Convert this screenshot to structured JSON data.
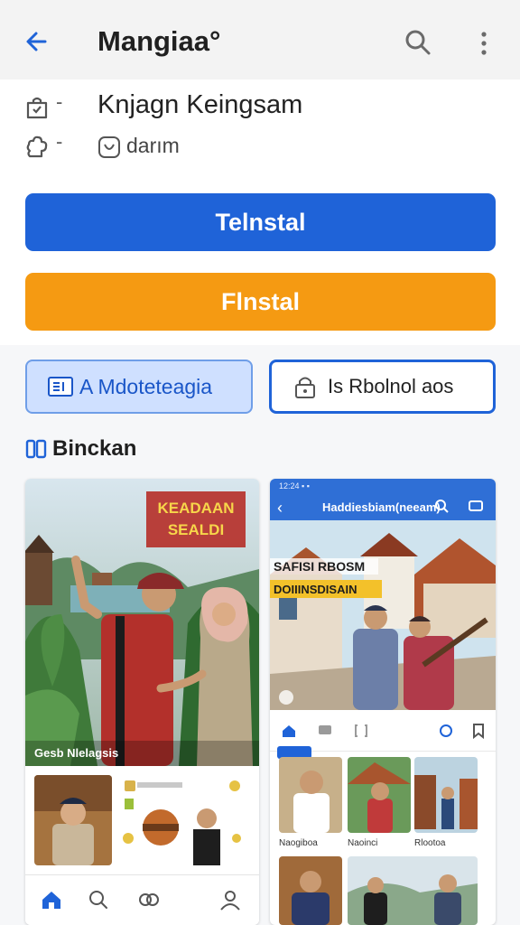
{
  "app_bar": {
    "title": "Mangiaa°",
    "back_icon": "arrow-back-icon",
    "search_icon": "search-icon",
    "menu_icon": "more-vert-icon"
  },
  "info": {
    "row1_text": "Knjagn Keingsam",
    "row1_dash": "-",
    "row2_text": "darım",
    "row2_dash": "-"
  },
  "buttons": {
    "primary_label": "Telnstal",
    "secondary_label": "Flnstal"
  },
  "chips": {
    "left_label": "A Mdoteteagia",
    "right_label": "Is Rbolnol aos"
  },
  "section": {
    "title": "Binckan"
  },
  "card_a": {
    "badge_line1": "KEADAAN",
    "badge_line2": "SEALDI",
    "caption": "Gesb Nlelagsis"
  },
  "card_b": {
    "status": "12:24 ▪ ▪",
    "title": "Haddiesbiam(neeam)",
    "overlay_line1": "SAFISI RBOSM",
    "overlay_line2": "DOIIINSDISAIN",
    "grid_labels": [
      "Naogiboa",
      "Naoinci",
      "Rlootoa"
    ]
  },
  "colors": {
    "primary": "#1f63d8",
    "accent": "#f59a12",
    "chip_bg": "#cfe0ff"
  }
}
